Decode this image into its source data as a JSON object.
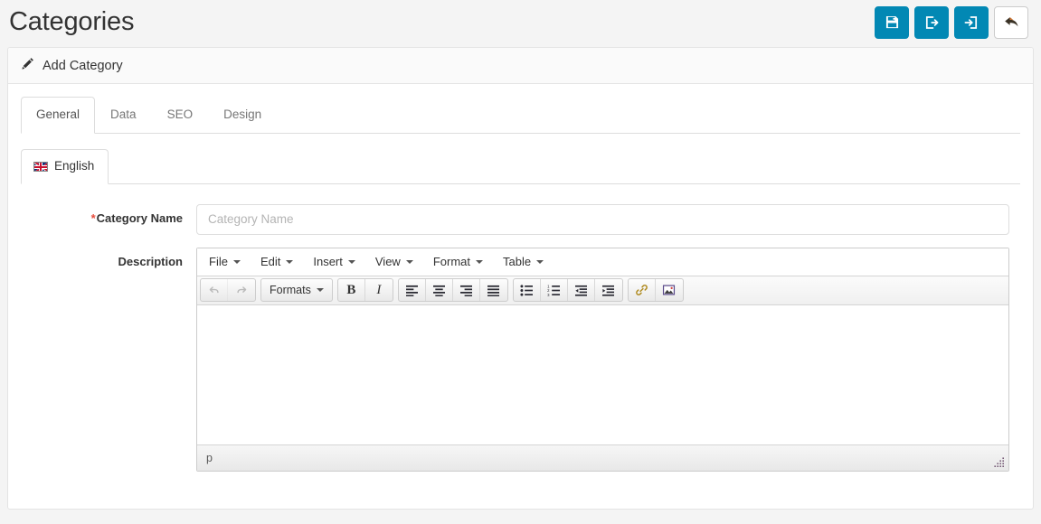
{
  "header": {
    "title": "Categories",
    "buttons": [
      {
        "name": "save-button",
        "icon": "floppy-disk-icon",
        "style": "primary"
      },
      {
        "name": "save-stay-button",
        "icon": "sign-out-icon",
        "style": "primary"
      },
      {
        "name": "save-new-button",
        "icon": "sign-in-icon",
        "style": "primary"
      },
      {
        "name": "back-button",
        "icon": "reply-arrow-icon",
        "style": "default"
      }
    ]
  },
  "panel": {
    "heading_icon": "pencil-icon",
    "heading_title": "Add Category"
  },
  "tabs": [
    {
      "label": "General",
      "active": true
    },
    {
      "label": "Data",
      "active": false
    },
    {
      "label": "SEO",
      "active": false
    },
    {
      "label": "Design",
      "active": false
    }
  ],
  "language_tabs": [
    {
      "label": "English",
      "flag": "uk-flag-icon",
      "active": true
    }
  ],
  "form": {
    "category_name": {
      "required_mark": "*",
      "label": "Category Name",
      "value": "",
      "placeholder": "Category Name"
    },
    "description": {
      "label": "Description"
    }
  },
  "editor": {
    "menubar": [
      {
        "label": "File"
      },
      {
        "label": "Edit"
      },
      {
        "label": "Insert"
      },
      {
        "label": "View"
      },
      {
        "label": "Format"
      },
      {
        "label": "Table"
      }
    ],
    "toolbar_groups": [
      {
        "buttons": [
          {
            "name": "undo-icon",
            "label": "",
            "disabled": true
          },
          {
            "name": "redo-icon",
            "label": "",
            "disabled": true
          }
        ]
      },
      {
        "buttons": [
          {
            "name": "formats-dropdown",
            "label": "Formats",
            "disabled": false
          }
        ]
      },
      {
        "buttons": [
          {
            "name": "bold-icon",
            "label": "B",
            "disabled": false
          },
          {
            "name": "italic-icon",
            "label": "I",
            "disabled": false
          }
        ]
      },
      {
        "buttons": [
          {
            "name": "align-left-icon",
            "label": "",
            "disabled": false
          },
          {
            "name": "align-center-icon",
            "label": "",
            "disabled": false
          },
          {
            "name": "align-right-icon",
            "label": "",
            "disabled": false
          },
          {
            "name": "align-justify-icon",
            "label": "",
            "disabled": false
          }
        ]
      },
      {
        "buttons": [
          {
            "name": "bullet-list-icon",
            "label": "",
            "disabled": false
          },
          {
            "name": "numbered-list-icon",
            "label": "",
            "disabled": false
          },
          {
            "name": "outdent-icon",
            "label": "",
            "disabled": false
          },
          {
            "name": "indent-icon",
            "label": "",
            "disabled": false
          }
        ]
      },
      {
        "buttons": [
          {
            "name": "link-icon",
            "label": "",
            "disabled": false
          },
          {
            "name": "image-icon",
            "label": "",
            "disabled": false
          }
        ]
      }
    ],
    "content": "",
    "statusbar_path": "p",
    "resize_handle": "resize-grip-icon"
  },
  "colors": {
    "accent": "#0288b4",
    "page_bg": "#f4f4f4",
    "panel_bg": "#ffffff",
    "required": "#e74c3c"
  }
}
